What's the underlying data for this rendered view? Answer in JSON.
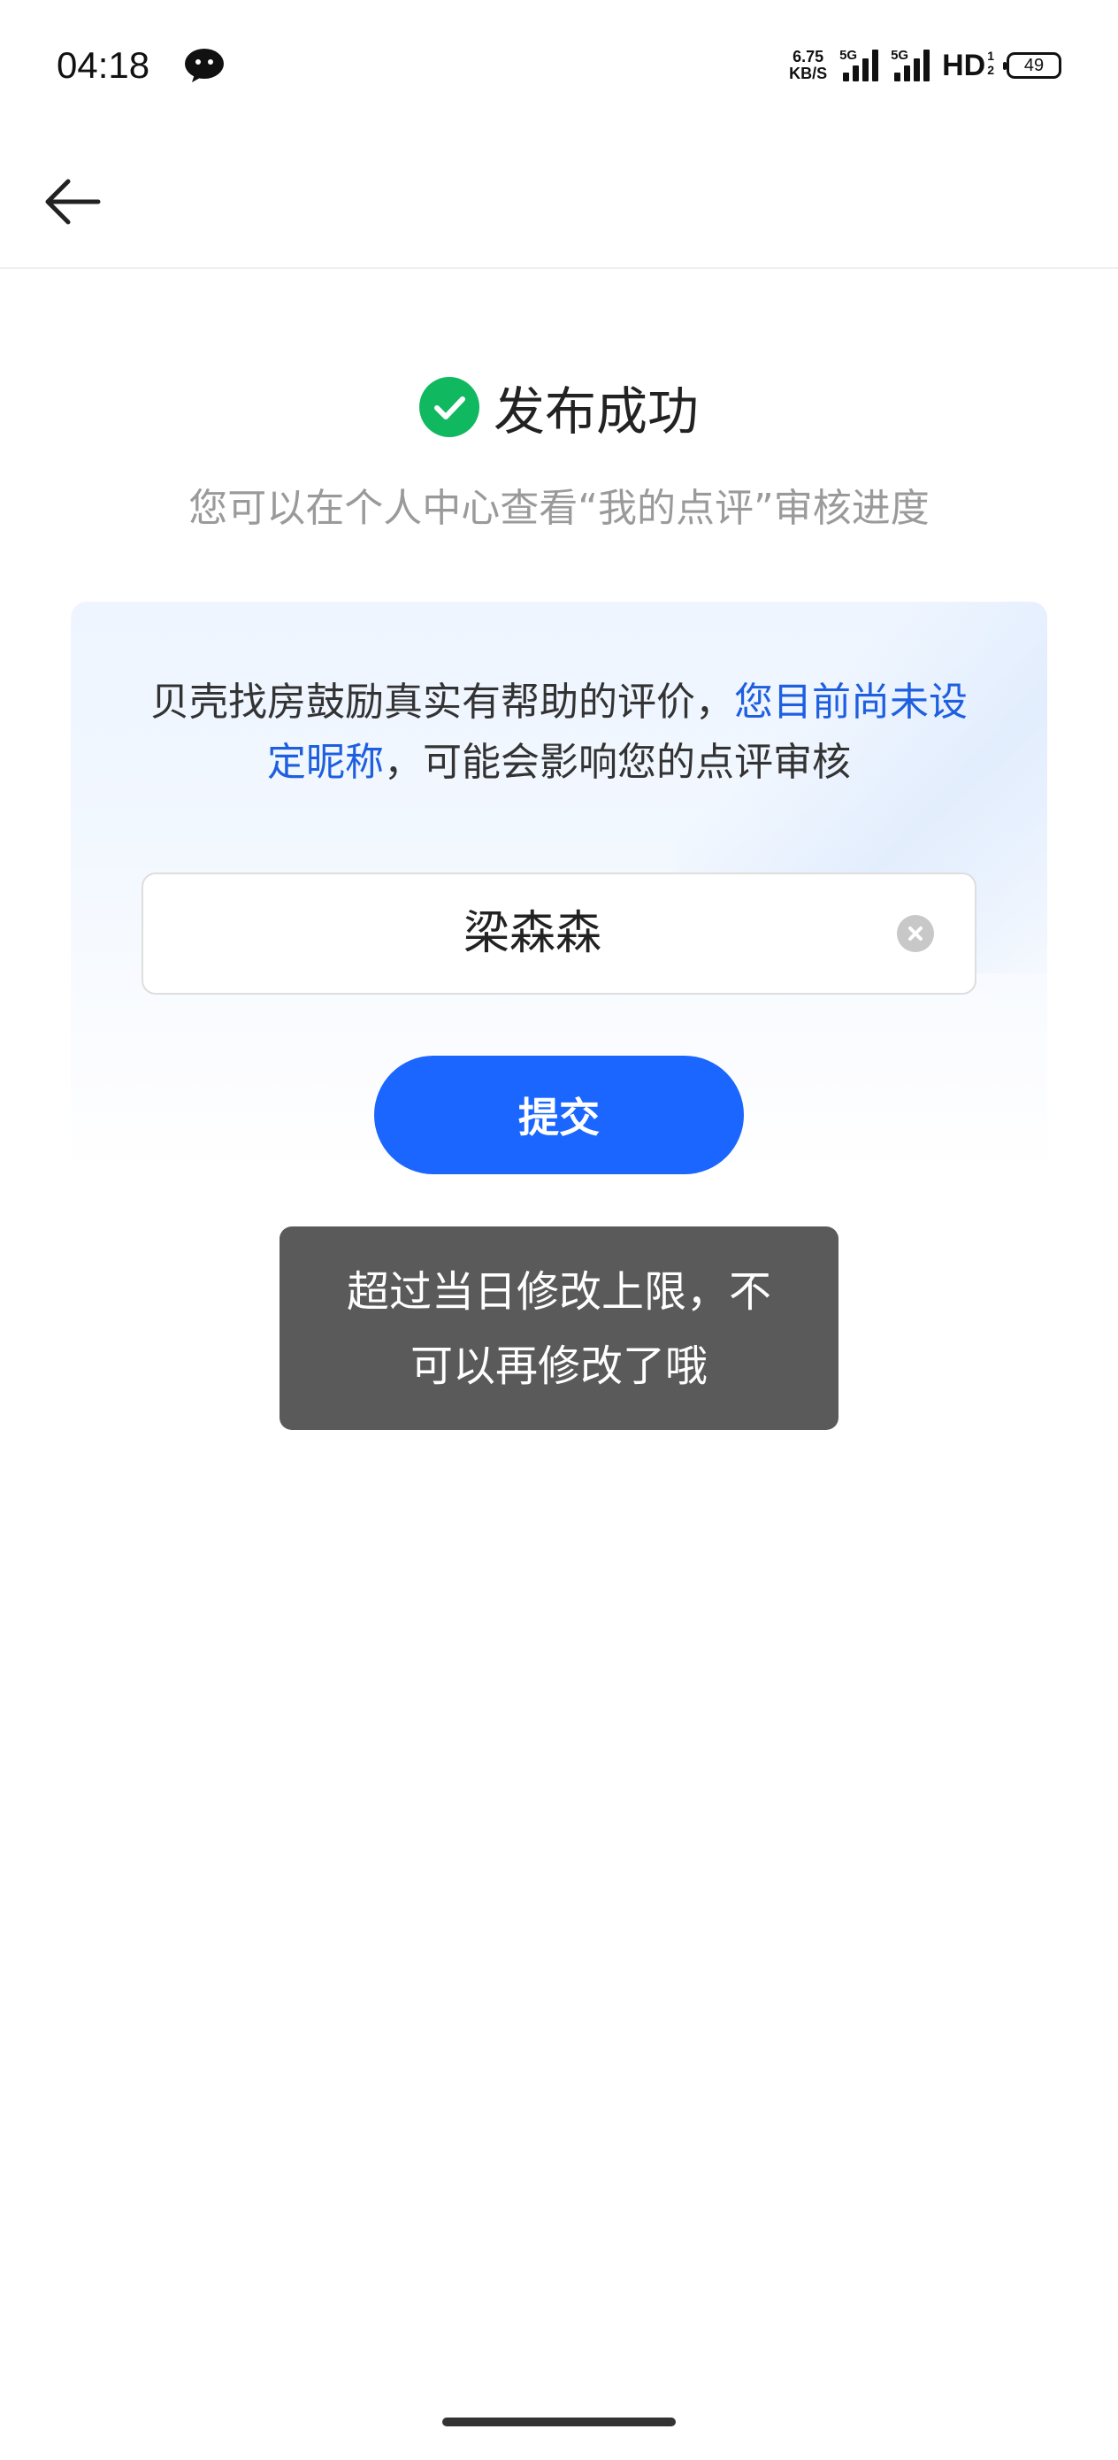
{
  "status_bar": {
    "time": "04:18",
    "net_speed_value": "6.75",
    "net_speed_unit": "KB/S",
    "signal1_tag": "5G",
    "signal2_tag": "5G",
    "hd_label": "HD",
    "hd_sup1": "1",
    "hd_sup2": "2",
    "battery": "49",
    "icons": [
      "wechat-icon",
      "signal-icon",
      "hd-icon",
      "battery-icon"
    ]
  },
  "nav": {
    "back_icon": "arrow-left-icon"
  },
  "success": {
    "title": "发布成功",
    "subtitle": "您可以在个人中心查看“我的点评”审核进度",
    "icon": "check-circle-icon",
    "icon_color": "#10b95f"
  },
  "card": {
    "text_normal_1": "贝壳找房鼓励真实有帮助的评价，",
    "text_highlight": "您目前尚未设定昵称",
    "text_normal_2": "，可能会影响您的点评审核",
    "highlight_color": "#1e5fe0",
    "nickname_value": "梁森森",
    "clear_icon": "clear-circle-icon",
    "submit_label": "提交",
    "submit_color": "#1a66ff"
  },
  "toast": {
    "line1": "超过当日修改上限，不",
    "line2": "可以再修改了哦"
  }
}
